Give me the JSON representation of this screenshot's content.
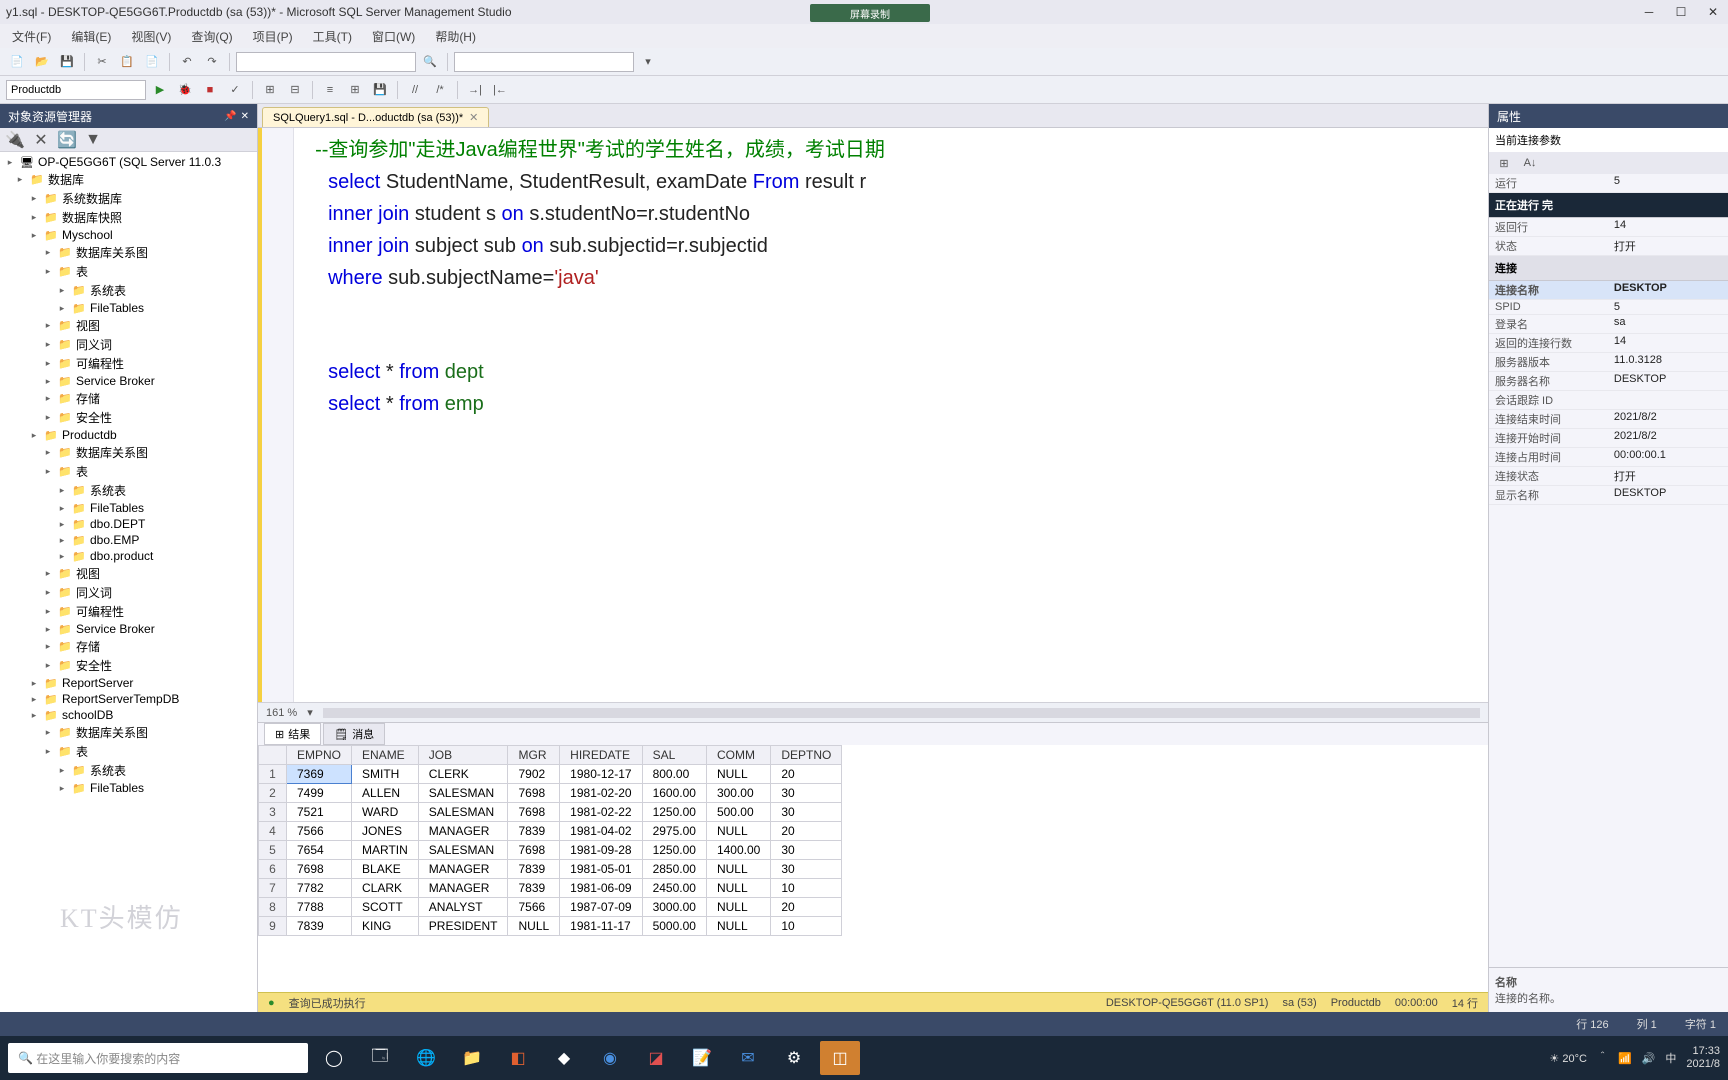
{
  "window": {
    "title": "y1.sql - DESKTOP-QE5GG6T.Productdb (sa (53))* - Microsoft SQL Server Management Studio",
    "overlay_badge": "屏幕录制"
  },
  "menu": [
    "文件(F)",
    "编辑(E)",
    "视图(V)",
    "查询(Q)",
    "项目(P)",
    "工具(T)",
    "窗口(W)",
    "帮助(H)"
  ],
  "db_selector": "Productdb",
  "doc_tab": "SQLQuery1.sql - D...oductdb (sa (53))*",
  "editor": {
    "line1": "  --查询参加\"走进Java编程世界\"考试的学生姓名，成绩，考试日期",
    "line2_a": "select",
    "line2_b": " StudentName, StudentResult, examDate ",
    "line2_c": "From",
    "line2_d": " result r",
    "line3_a": "inner join",
    "line3_b": " student s ",
    "line3_c": "on",
    "line3_d": " s.studentNo=r.studentNo",
    "line4_a": "inner join",
    "line4_b": " subject sub ",
    "line4_c": "on",
    "line4_d": " sub.subjectid=r.subjectid",
    "line5_a": "where",
    "line5_b": " sub.subjectName=",
    "line5_c": "'java'",
    "line7_a": "select",
    "line7_b": " * ",
    "line7_c": "from",
    "line7_d": " dept",
    "line8_a": "select",
    "line8_b": " * ",
    "line8_c": "from",
    "line8_d": " emp"
  },
  "zoom": "161 %",
  "object_explorer": {
    "title": "对象资源管理器",
    "root": "OP-QE5GG6T (SQL Server 11.0.3",
    "nodes": [
      {
        "t": "数据库",
        "d": 1
      },
      {
        "t": "系统数据库",
        "d": 2
      },
      {
        "t": "数据库快照",
        "d": 2
      },
      {
        "t": "Myschool",
        "d": 2
      },
      {
        "t": "数据库关系图",
        "d": 3
      },
      {
        "t": "表",
        "d": 3
      },
      {
        "t": "系统表",
        "d": 4
      },
      {
        "t": "FileTables",
        "d": 4
      },
      {
        "t": "视图",
        "d": 3
      },
      {
        "t": "同义词",
        "d": 3
      },
      {
        "t": "可编程性",
        "d": 3
      },
      {
        "t": "Service Broker",
        "d": 3
      },
      {
        "t": "存储",
        "d": 3
      },
      {
        "t": "安全性",
        "d": 3
      },
      {
        "t": "Productdb",
        "d": 2
      },
      {
        "t": "数据库关系图",
        "d": 3
      },
      {
        "t": "表",
        "d": 3
      },
      {
        "t": "系统表",
        "d": 4
      },
      {
        "t": "FileTables",
        "d": 4
      },
      {
        "t": "dbo.DEPT",
        "d": 4
      },
      {
        "t": "dbo.EMP",
        "d": 4
      },
      {
        "t": "dbo.product",
        "d": 4
      },
      {
        "t": "视图",
        "d": 3
      },
      {
        "t": "同义词",
        "d": 3
      },
      {
        "t": "可编程性",
        "d": 3
      },
      {
        "t": "Service Broker",
        "d": 3
      },
      {
        "t": "存储",
        "d": 3
      },
      {
        "t": "安全性",
        "d": 3
      },
      {
        "t": "ReportServer",
        "d": 2
      },
      {
        "t": "ReportServerTempDB",
        "d": 2
      },
      {
        "t": "schoolDB",
        "d": 2
      },
      {
        "t": "数据库关系图",
        "d": 3
      },
      {
        "t": "表",
        "d": 3
      },
      {
        "t": "系统表",
        "d": 4
      },
      {
        "t": "FileTables",
        "d": 4
      }
    ]
  },
  "result": {
    "tab_results": "结果",
    "tab_messages": "消息",
    "columns": [
      "EMPNO",
      "ENAME",
      "JOB",
      "MGR",
      "HIREDATE",
      "SAL",
      "COMM",
      "DEPTNO"
    ],
    "rows": [
      [
        "7369",
        "SMITH",
        "CLERK",
        "7902",
        "1980-12-17",
        "800.00",
        "NULL",
        "20"
      ],
      [
        "7499",
        "ALLEN",
        "SALESMAN",
        "7698",
        "1981-02-20",
        "1600.00",
        "300.00",
        "30"
      ],
      [
        "7521",
        "WARD",
        "SALESMAN",
        "7698",
        "1981-02-22",
        "1250.00",
        "500.00",
        "30"
      ],
      [
        "7566",
        "JONES",
        "MANAGER",
        "7839",
        "1981-04-02",
        "2975.00",
        "NULL",
        "20"
      ],
      [
        "7654",
        "MARTIN",
        "SALESMAN",
        "7698",
        "1981-09-28",
        "1250.00",
        "1400.00",
        "30"
      ],
      [
        "7698",
        "BLAKE",
        "MANAGER",
        "7839",
        "1981-05-01",
        "2850.00",
        "NULL",
        "30"
      ],
      [
        "7782",
        "CLARK",
        "MANAGER",
        "7839",
        "1981-06-09",
        "2450.00",
        "NULL",
        "10"
      ],
      [
        "7788",
        "SCOTT",
        "ANALYST",
        "7566",
        "1987-07-09",
        "3000.00",
        "NULL",
        "20"
      ],
      [
        "7839",
        "KING",
        "PRESIDENT",
        "NULL",
        "1981-11-17",
        "5000.00",
        "NULL",
        "10"
      ]
    ]
  },
  "status": {
    "exec": "查询已成功执行",
    "server": "DESKTOP-QE5GG6T (11.0 SP1)",
    "user": "sa (53)",
    "db": "Productdb",
    "time": "00:00:00",
    "rows": "14 行"
  },
  "properties": {
    "title": "属性",
    "subtitle": "当前连接参数",
    "section_active": "正在进行 完",
    "cat_conn": "连接",
    "items": [
      {
        "k": "运行",
        "v": "5"
      },
      {
        "k": "返回行",
        "v": "14"
      },
      {
        "k": "状态",
        "v": "打开"
      },
      {
        "k": "连接名称",
        "v": "DESKTOP"
      },
      {
        "k": "SPID",
        "v": "5"
      },
      {
        "k": "登录名",
        "v": "sa"
      },
      {
        "k": "返回的连接行数",
        "v": "14"
      },
      {
        "k": "服务器版本",
        "v": "11.0.3128"
      },
      {
        "k": "服务器名称",
        "v": "DESKTOP"
      },
      {
        "k": "会话跟踪 ID",
        "v": ""
      },
      {
        "k": "连接结束时间",
        "v": "2021/8/2"
      },
      {
        "k": "连接开始时间",
        "v": "2021/8/2"
      },
      {
        "k": "连接占用时间",
        "v": "00:00:00.1"
      },
      {
        "k": "连接状态",
        "v": "打开"
      },
      {
        "k": "显示名称",
        "v": "DESKTOP"
      }
    ],
    "desc_title": "名称",
    "desc_text": "连接的名称。"
  },
  "bottom": {
    "line": "行 126",
    "col": "列 1",
    "char": "字符 1"
  },
  "taskbar": {
    "search_placeholder": "在这里输入你要搜索的内容",
    "weather": "20°C",
    "time": "17:33",
    "date": "2021/8"
  },
  "watermark": "KT头模仿"
}
